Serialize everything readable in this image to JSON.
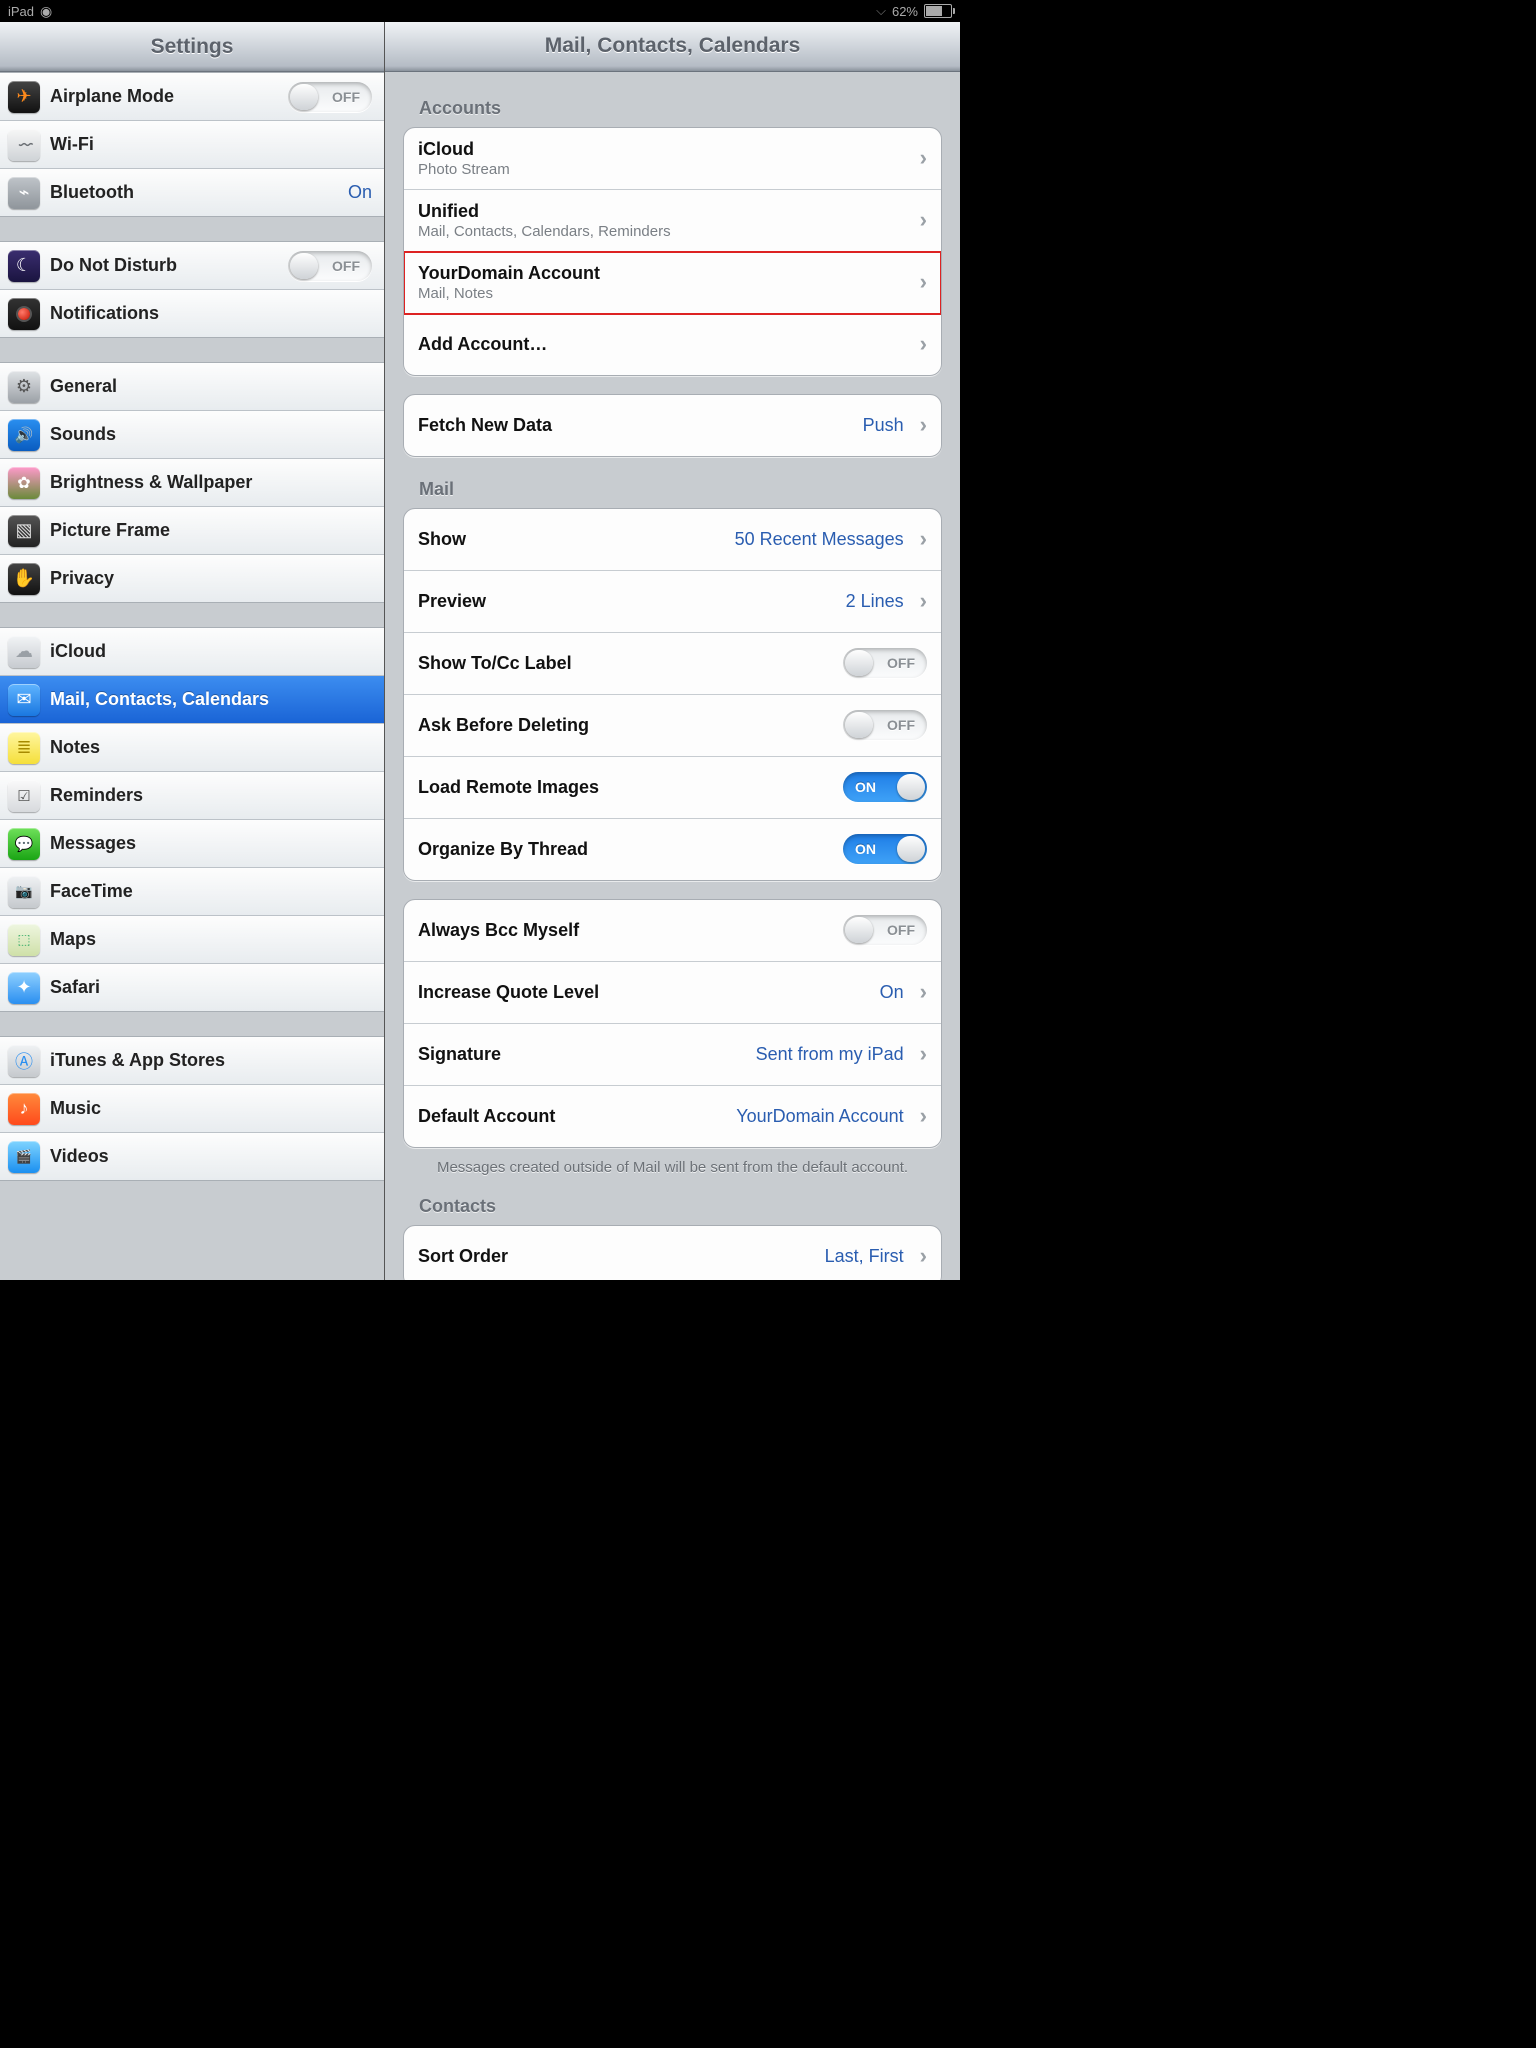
{
  "status": {
    "device": "iPad",
    "battery_pct": "62%",
    "battery_fill_css": "60%"
  },
  "left_header": "Settings",
  "right_header": "Mail, Contacts, Calendars",
  "toggle_on": "ON",
  "toggle_off": "OFF",
  "sidebar": {
    "g1": [
      {
        "icon": "ic-airplane",
        "name": "airplane-mode",
        "label": "Airplane Mode",
        "toggle": "off"
      },
      {
        "icon": "ic-wifi",
        "name": "wifi",
        "label": "Wi-Fi"
      },
      {
        "icon": "ic-bt",
        "name": "bluetooth",
        "label": "Bluetooth",
        "value": "On"
      }
    ],
    "g2": [
      {
        "icon": "ic-dnd",
        "name": "do-not-disturb",
        "label": "Do Not Disturb",
        "toggle": "off"
      },
      {
        "icon": "ic-notif",
        "name": "notifications",
        "label": "Notifications"
      }
    ],
    "g3": [
      {
        "icon": "ic-general",
        "name": "general",
        "label": "General"
      },
      {
        "icon": "ic-sounds",
        "name": "sounds",
        "label": "Sounds"
      },
      {
        "icon": "ic-bright",
        "name": "brightness-wallpaper",
        "label": "Brightness & Wallpaper"
      },
      {
        "icon": "ic-frame",
        "name": "picture-frame",
        "label": "Picture Frame"
      },
      {
        "icon": "ic-privacy",
        "name": "privacy",
        "label": "Privacy"
      }
    ],
    "g4": [
      {
        "icon": "ic-icloud",
        "name": "icloud",
        "label": "iCloud"
      },
      {
        "icon": "ic-mail",
        "name": "mail-contacts-calendars",
        "label": "Mail, Contacts, Calendars",
        "selected": true
      },
      {
        "icon": "ic-notes",
        "name": "notes",
        "label": "Notes"
      },
      {
        "icon": "ic-rem",
        "name": "reminders",
        "label": "Reminders"
      },
      {
        "icon": "ic-msg",
        "name": "messages",
        "label": "Messages"
      },
      {
        "icon": "ic-ft",
        "name": "facetime",
        "label": "FaceTime"
      },
      {
        "icon": "ic-maps",
        "name": "maps",
        "label": "Maps"
      },
      {
        "icon": "ic-safari",
        "name": "safari",
        "label": "Safari"
      }
    ],
    "g5": [
      {
        "icon": "ic-appstore",
        "name": "itunes-app-stores",
        "label": "iTunes & App Stores"
      },
      {
        "icon": "ic-music",
        "name": "music",
        "label": "Music"
      },
      {
        "icon": "ic-videos",
        "name": "videos",
        "label": "Videos"
      }
    ]
  },
  "detail": {
    "accounts_header": "Accounts",
    "accounts": [
      {
        "title": "iCloud",
        "sub": "Photo Stream"
      },
      {
        "title": "Unified",
        "sub": "Mail, Contacts, Calendars, Reminders"
      },
      {
        "title": "YourDomain Account",
        "sub": "Mail, Notes",
        "highlight": true
      },
      {
        "title": "Add Account…"
      }
    ],
    "fetch": {
      "label": "Fetch New Data",
      "value": "Push"
    },
    "mail_header": "Mail",
    "mail1": [
      {
        "label": "Show",
        "value": "50 Recent Messages",
        "chev": true
      },
      {
        "label": "Preview",
        "value": "2 Lines",
        "chev": true
      },
      {
        "label": "Show To/Cc Label",
        "toggle": "off"
      },
      {
        "label": "Ask Before Deleting",
        "toggle": "off"
      },
      {
        "label": "Load Remote Images",
        "toggle": "on"
      },
      {
        "label": "Organize By Thread",
        "toggle": "on"
      }
    ],
    "mail2": [
      {
        "label": "Always Bcc Myself",
        "toggle": "off"
      },
      {
        "label": "Increase Quote Level",
        "value": "On",
        "chev": true
      },
      {
        "label": "Signature",
        "value": "Sent from my iPad",
        "chev": true
      },
      {
        "label": "Default Account",
        "value": "YourDomain Account",
        "chev": true
      }
    ],
    "mail_footer": "Messages created outside of Mail will be sent from the default account.",
    "contacts_header": "Contacts",
    "contacts": [
      {
        "label": "Sort Order",
        "value": "Last, First",
        "chev": true
      }
    ]
  }
}
